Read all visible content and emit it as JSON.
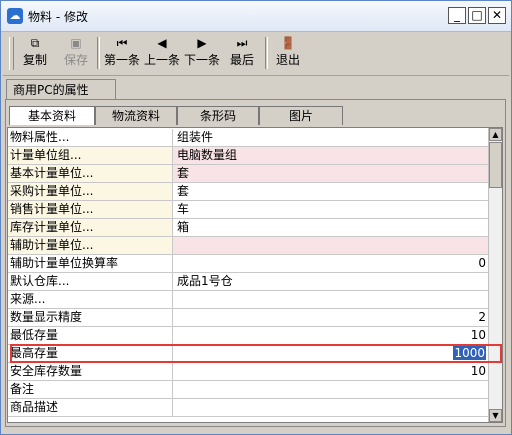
{
  "window": {
    "title": "物料 - 修改",
    "app_icon": "cloud-app-icon"
  },
  "toolbar": {
    "copy": "复制",
    "save": "保存",
    "first": "第一条",
    "prev": "上一条",
    "next": "下一条",
    "last": "最后",
    "exit": "退出"
  },
  "group_tab": "商用PC的属性",
  "tabs": [
    "基本资料",
    "物流资料",
    "条形码",
    "图片"
  ],
  "rows": [
    {
      "name": "物料属性...",
      "value": "组装件"
    },
    {
      "name": "计量单位组...",
      "value": "电脑数量组"
    },
    {
      "name": "基本计量单位...",
      "value": "套"
    },
    {
      "name": "采购计量单位...",
      "value": "套"
    },
    {
      "name": "销售计量单位...",
      "value": "车"
    },
    {
      "name": "库存计量单位...",
      "value": "箱"
    },
    {
      "name": "辅助计量单位...",
      "value": ""
    },
    {
      "name": "辅助计量单位换算率",
      "value": "0"
    },
    {
      "name": "默认仓库...",
      "value": "成品1号仓"
    },
    {
      "name": "来源...",
      "value": ""
    },
    {
      "name": "数量显示精度",
      "value": "2"
    },
    {
      "name": "最低存量",
      "value": "10"
    },
    {
      "name": "最高存量",
      "value": "1000"
    },
    {
      "name": "安全库存数量",
      "value": "10"
    },
    {
      "name": "备注",
      "value": ""
    },
    {
      "name": "商品描述",
      "value": ""
    }
  ],
  "colors": {
    "required_name_bg": "#fbf7e3",
    "required_value_bg": "#f8e3e6",
    "highlight": "#e53935",
    "selection": "#2f62b8"
  }
}
